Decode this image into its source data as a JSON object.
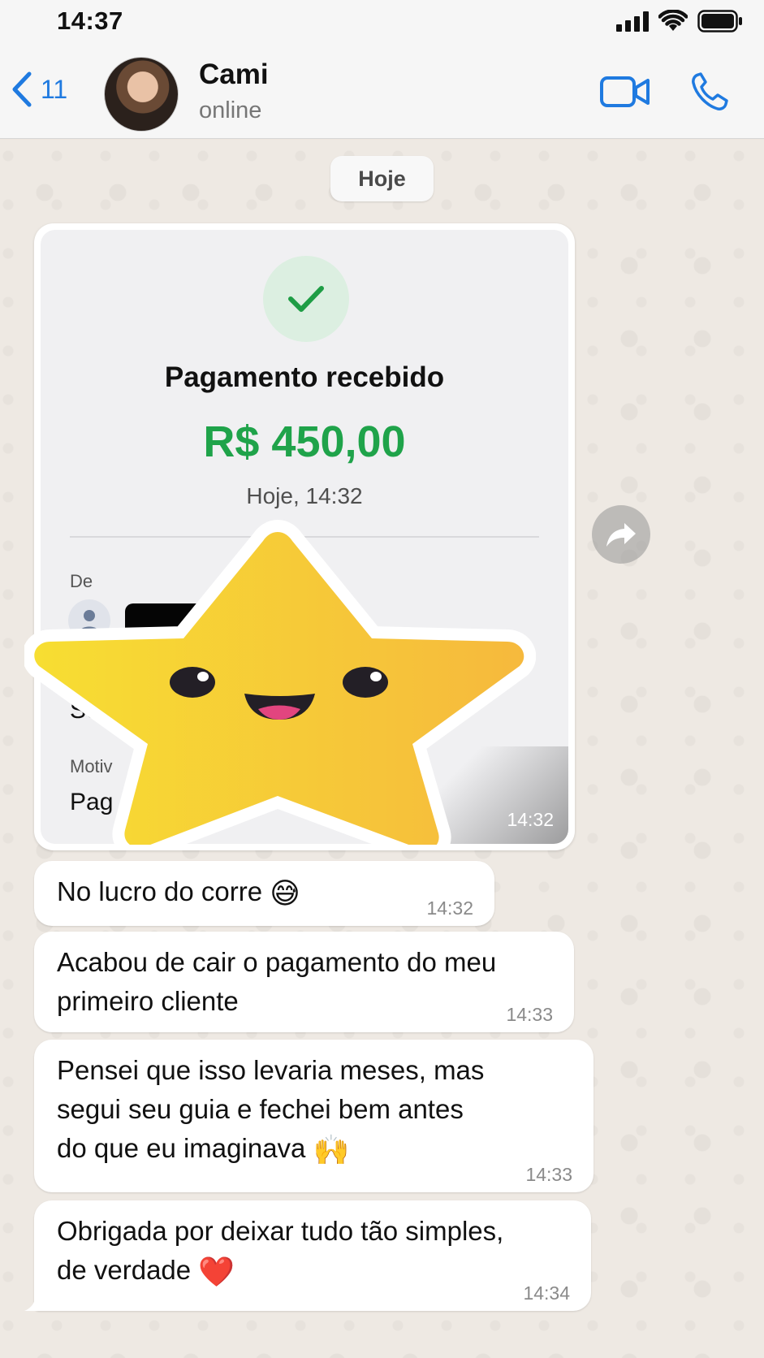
{
  "status_bar": {
    "time": "14:37",
    "icons": [
      "signal-icon",
      "wifi-icon",
      "battery-icon"
    ]
  },
  "header": {
    "back_count": "11",
    "contact_name": "Cami",
    "contact_status": "online",
    "accent_color": "#1f7ae0",
    "actions": [
      "video-call-icon",
      "phone-call-icon"
    ]
  },
  "chat": {
    "date_divider": "Hoje",
    "image_message": {
      "receipt": {
        "title": "Pagamento recebido",
        "amount": "R$ 450,00",
        "amount_color": "#1fa34a",
        "date": "Hoje, 14:32",
        "from_label": "De",
        "partial_field_value": "Se",
        "motivo_label": "Motiv",
        "motivo_value": "Pag"
      },
      "sticker": "smiling-star-sticker",
      "time": "14:32"
    },
    "messages": [
      {
        "text": "No lucro do corre",
        "emoji": "😅",
        "time": "14:32"
      },
      {
        "line1": "Acabou de cair o pagamento do meu",
        "line2": "primeiro cliente",
        "time": "14:33"
      },
      {
        "line1": "Pensei que isso levaria meses, mas",
        "line2": "segui seu guia e fechei bem antes",
        "line3": "do que eu imaginava",
        "emoji": "🙌",
        "time": "14:33"
      },
      {
        "line1": "Obrigada por deixar tudo tão simples,",
        "line2": "de verdade",
        "emoji": "❤️",
        "time": "14:34"
      }
    ]
  }
}
